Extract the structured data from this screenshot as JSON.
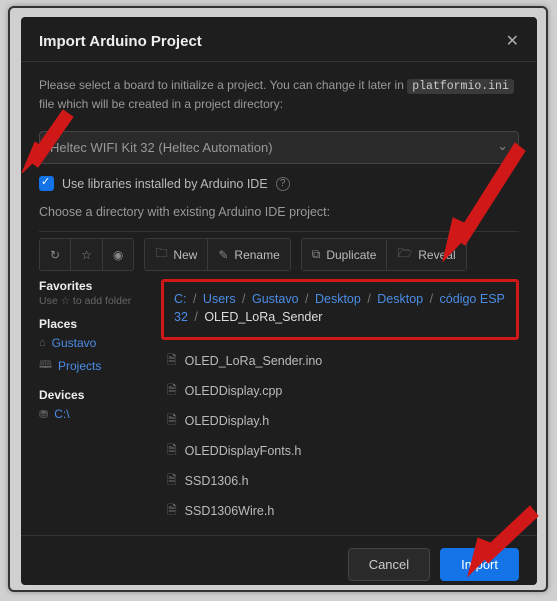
{
  "modal": {
    "title": "Import Arduino Project",
    "description_prefix": "Please select a board to initialize a project. You can change it later in ",
    "description_code": "platformio.ini",
    "description_suffix": " file which will be created in a project directory:"
  },
  "board_select": "Heltec WIFI Kit 32 (Heltec Automation)",
  "libs_checkbox_label": "Use libraries installed by Arduino IDE",
  "dir_label": "Choose a directory with existing Arduino IDE project:",
  "toolbar": {
    "refresh": "↻",
    "star": "☆",
    "eye": "◉",
    "new": "New",
    "rename": "Rename",
    "duplicate": "Duplicate",
    "reveal": "Reveal"
  },
  "sidebar": {
    "favorites_title": "Favorites",
    "favorites_hint": "Use ☆ to add folder",
    "places_title": "Places",
    "places": [
      {
        "icon": "⌂",
        "label": "Gustavo"
      },
      {
        "icon": "🕮",
        "label": "Projects"
      }
    ],
    "devices_title": "Devices",
    "devices": [
      {
        "icon": "⛃",
        "label": "C:\\"
      }
    ]
  },
  "breadcrumb": [
    "C:",
    "Users",
    "Gustavo",
    "Desktop",
    "Desktop",
    "código ESP32",
    "OLED_LoRa_Sender"
  ],
  "files": [
    "OLED_LoRa_Sender.ino",
    "OLEDDisplay.cpp",
    "OLEDDisplay.h",
    "OLEDDisplayFonts.h",
    "SSD1306.h",
    "SSD1306Wire.h"
  ],
  "footer": {
    "cancel": "Cancel",
    "import": "Import"
  }
}
